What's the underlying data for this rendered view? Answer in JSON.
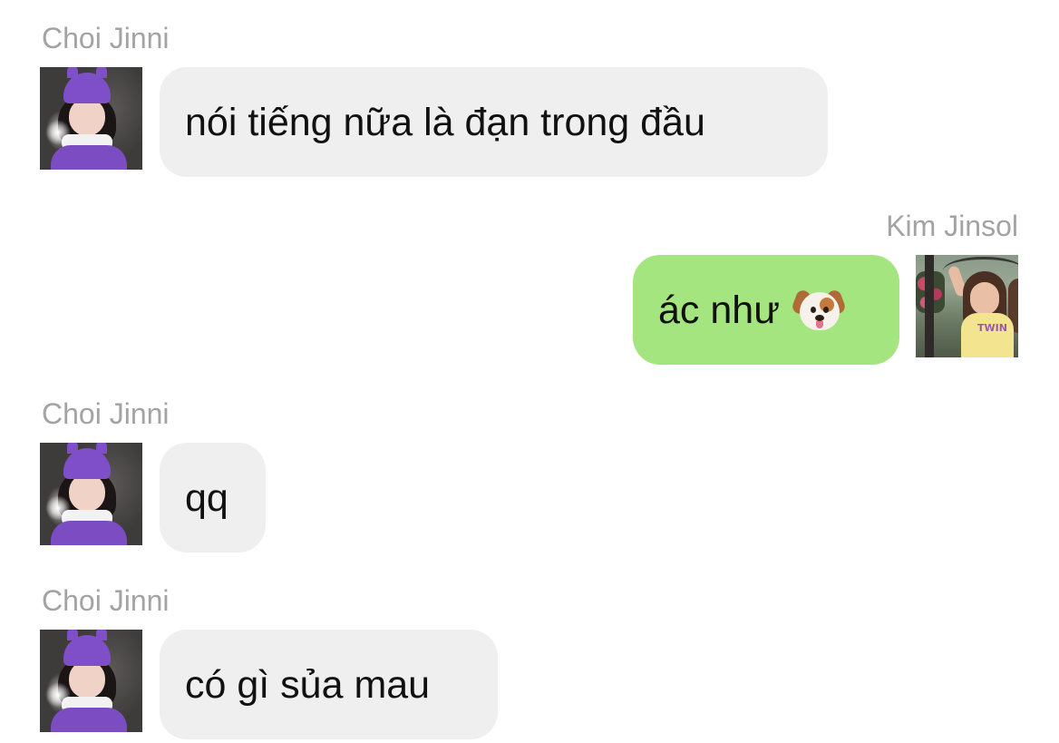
{
  "messages": [
    {
      "sender": "Choi Jinni",
      "side": "incoming",
      "text": "nói tiếng nữa là đạn trong đầu"
    },
    {
      "sender": "Kim Jinsol",
      "side": "outgoing",
      "text": "ác như",
      "emoji": "dog-face-icon"
    },
    {
      "sender": "Choi Jinni",
      "side": "incoming",
      "text": "qq"
    },
    {
      "sender": "Choi Jinni",
      "side": "incoming",
      "text": "có gì sủa mau"
    }
  ],
  "colors": {
    "incoming_bubble": "#efefef",
    "outgoing_bubble": "#a4e57f",
    "sender_name": "#a3a3a3",
    "message_text": "#111111",
    "background": "#ffffff"
  }
}
